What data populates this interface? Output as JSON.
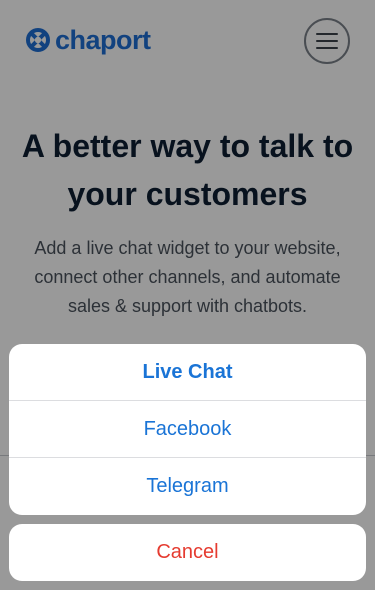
{
  "header": {
    "logo_text": "chaport",
    "logo_icon": "chaport-logo-icon",
    "menu_icon": "hamburger-icon"
  },
  "hero": {
    "title": "A better way to talk to your customers",
    "subtitle": "Add a live chat widget to your website, connect other channels, and automate sales & support with chatbots."
  },
  "action_sheet": {
    "options": [
      {
        "label": "Live Chat"
      },
      {
        "label": "Facebook"
      },
      {
        "label": "Telegram"
      }
    ],
    "cancel_label": "Cancel"
  },
  "colors": {
    "brand_blue": "#1f6fd4",
    "action_blue": "#1a74d6",
    "cancel_red": "#e53b30",
    "title_navy": "#0e1f33"
  }
}
